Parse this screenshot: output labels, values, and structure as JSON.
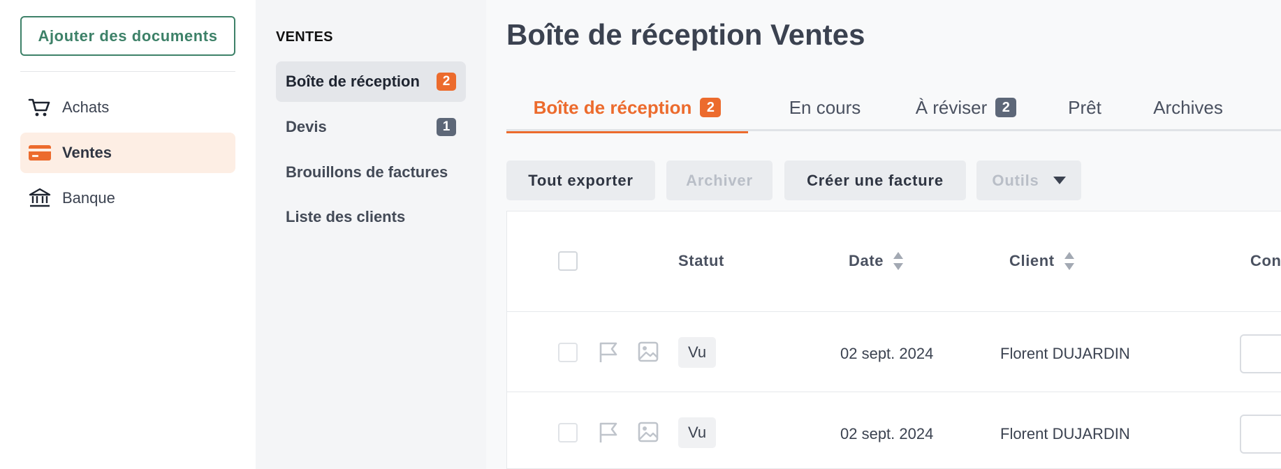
{
  "leftnav": {
    "add_documents": "Ajouter des documents",
    "items": [
      {
        "label": "Achats",
        "icon": "cart-icon"
      },
      {
        "label": "Ventes",
        "icon": "card-icon",
        "active": true
      },
      {
        "label": "Banque",
        "icon": "bank-icon"
      }
    ]
  },
  "subnav": {
    "section": "VENTES",
    "items": [
      {
        "label": "Boîte de réception",
        "badge": "2"
      },
      {
        "label": "Devis",
        "badge": "1"
      },
      {
        "label": "Brouillons de factures"
      },
      {
        "label": "Liste des clients"
      }
    ]
  },
  "main": {
    "title": "Boîte de réception Ventes",
    "tabs": [
      {
        "label": "Boîte de réception",
        "badge": "2"
      },
      {
        "label": "En cours"
      },
      {
        "label": "À réviser",
        "badge": "2"
      },
      {
        "label": "Prêt"
      },
      {
        "label": "Archives"
      }
    ],
    "toolbar": {
      "export_all": "Tout exporter",
      "archive": "Archiver",
      "create_invoice": "Créer une facture",
      "tools": "Outils"
    },
    "table": {
      "headers": {
        "status": "Statut",
        "date": "Date",
        "client": "Client",
        "partial": "Con"
      },
      "rows": [
        {
          "status": "Vu",
          "date": "02 sept. 2024",
          "client": "Florent DUJARDIN"
        },
        {
          "status": "Vu",
          "date": "02 sept. 2024",
          "client": "Florent DUJARDIN"
        }
      ]
    }
  },
  "colors": {
    "accent": "#ec6b2d",
    "brand_green": "#3d8168",
    "badge_slate": "#5d6778"
  }
}
